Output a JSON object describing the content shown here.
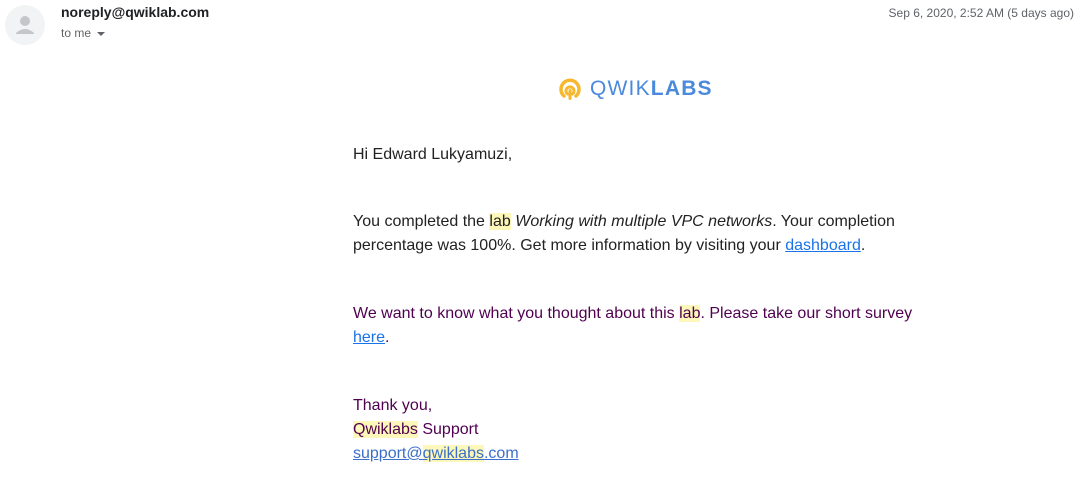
{
  "header": {
    "sender": "noreply@qwiklab.com",
    "recipient_label": "to me",
    "date": "Sep 6, 2020, 2:52 AM (5 days ago)"
  },
  "logo": {
    "text_thin": "QWIK",
    "text_bold": "LABS",
    "brand_color": "#4a89dc",
    "icon_color": "#f5b82e"
  },
  "body": {
    "greeting": "Hi Edward Lukyamuzi,",
    "p1_before": "You completed the ",
    "p1_highlight": "lab",
    "p1_space": " ",
    "p1_lab_name": "Working with multiple VPC networks",
    "p1_after": ". Your completion percentage was 100%. Get more information by visiting your ",
    "p1_link": "dashboard",
    "p1_end": ".",
    "p2_before": "We want to know what you thought about this ",
    "p2_highlight": "lab",
    "p2_after": ". Please take our short survey ",
    "p2_link": "here",
    "p2_end": ".",
    "sign_off": "Thank you,",
    "team_highlight": "Qwiklabs",
    "team_after": " Support",
    "email_before": "support@",
    "email_highlight": "qwiklabs",
    "email_after": ".com"
  }
}
